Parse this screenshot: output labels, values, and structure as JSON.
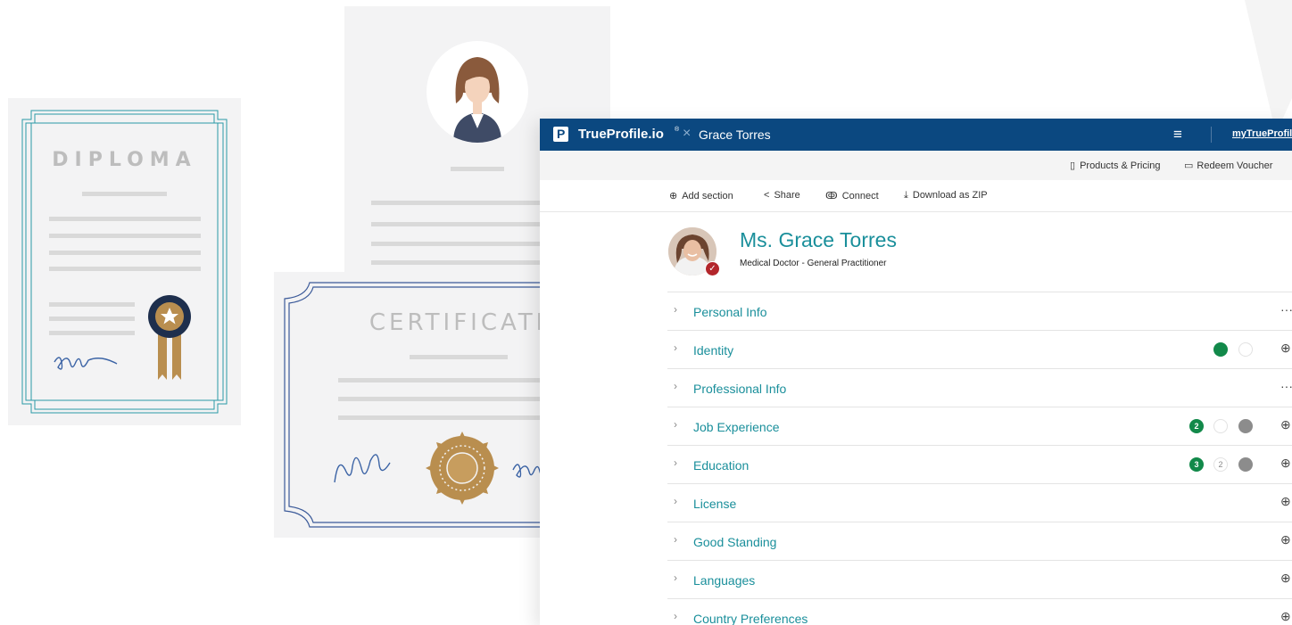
{
  "diploma": {
    "title": "DIPLOMA"
  },
  "certificate": {
    "title": "CERTIFICATE"
  },
  "app": {
    "brand": "TrueProfile.io",
    "brand_mark": "®",
    "separator": "×",
    "user_name": "Grace Torres",
    "menu_icon": "hamburger-icon",
    "my_link": "myTrueProfil",
    "subnav": {
      "products": "Products & Pricing",
      "voucher": "Redeem Voucher"
    },
    "toolbar": {
      "add_section": "Add section",
      "share": "Share",
      "connect": "Connect",
      "download": "Download as ZIP"
    },
    "profile": {
      "name": "Ms. Grace Torres",
      "title": "Medical Doctor - General Practitioner"
    },
    "sections": [
      {
        "label": "Personal Info",
        "action": "···",
        "indicators": []
      },
      {
        "label": "Identity",
        "action": "⊕",
        "indicators": [
          "green",
          "empty"
        ]
      },
      {
        "label": "Professional Info",
        "action": "···",
        "indicators": []
      },
      {
        "label": "Job Experience",
        "action": "⊕",
        "indicators": [
          "green:2",
          "empty",
          "grey"
        ]
      },
      {
        "label": "Education",
        "action": "⊕",
        "indicators": [
          "green:3",
          "empty:2",
          "grey"
        ]
      },
      {
        "label": "License",
        "action": "⊕",
        "indicators": []
      },
      {
        "label": "Good Standing",
        "action": "⊕",
        "indicators": []
      },
      {
        "label": "Languages",
        "action": "⊕",
        "indicators": []
      },
      {
        "label": "Country Preferences",
        "action": "⊕",
        "indicators": []
      }
    ],
    "indicator_numbers": {
      "job_green": "2",
      "edu_green": "3",
      "edu_empty": "2"
    },
    "colors": {
      "topbar": "#0b4880",
      "accent": "#1a8f9b",
      "green": "#12894a",
      "badge": "#b3262b",
      "gold": "#b98e4f"
    }
  }
}
